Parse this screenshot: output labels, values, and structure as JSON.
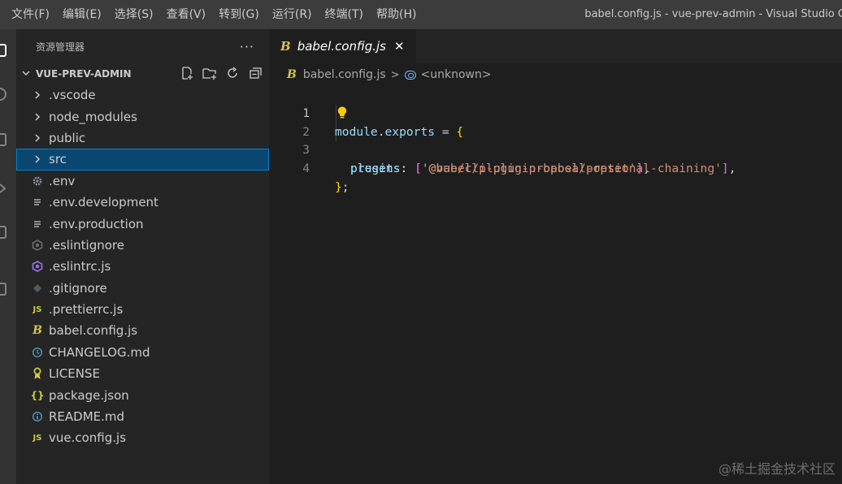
{
  "menubar": {
    "items": [
      "文件(F)",
      "编辑(E)",
      "选择(S)",
      "查看(V)",
      "转到(G)",
      "运行(R)",
      "终端(T)",
      "帮助(H)"
    ],
    "window_title": "babel.config.js - vue-prev-admin - Visual Studio C"
  },
  "sidebar": {
    "title": "资源管理器",
    "more_icon": "···",
    "project_name": "VUE-PREV-ADMIN",
    "items": [
      {
        "label": ".vscode",
        "icon": "chevron-right-icon",
        "type": "folder"
      },
      {
        "label": "node_modules",
        "icon": "chevron-right-icon",
        "type": "folder"
      },
      {
        "label": "public",
        "icon": "chevron-right-icon",
        "type": "folder"
      },
      {
        "label": "src",
        "icon": "chevron-right-icon",
        "type": "folder",
        "selected": true
      },
      {
        "label": ".env",
        "icon": "gear-icon",
        "type": "file"
      },
      {
        "label": ".env.development",
        "icon": "lines-icon",
        "type": "file"
      },
      {
        "label": ".env.production",
        "icon": "lines-icon",
        "type": "file"
      },
      {
        "label": ".eslintignore",
        "icon": "eslint-gray-icon",
        "type": "file"
      },
      {
        "label": ".eslintrc.js",
        "icon": "eslint-purple-icon",
        "type": "file"
      },
      {
        "label": ".gitignore",
        "icon": "git-icon",
        "type": "file"
      },
      {
        "label": ".prettierrc.js",
        "icon": "js-icon",
        "type": "file"
      },
      {
        "label": "babel.config.js",
        "icon": "babel-icon",
        "type": "file"
      },
      {
        "label": "CHANGELOG.md",
        "icon": "clock-icon",
        "type": "file"
      },
      {
        "label": "LICENSE",
        "icon": "license-icon",
        "type": "file"
      },
      {
        "label": "package.json",
        "icon": "json-icon",
        "type": "file"
      },
      {
        "label": "README.md",
        "icon": "info-icon",
        "type": "file"
      },
      {
        "label": "vue.config.js",
        "icon": "js-icon",
        "type": "file"
      }
    ]
  },
  "editor": {
    "tab_label": "babel.config.js",
    "tab_close": "✕",
    "breadcrumb": {
      "file": "babel.config.js",
      "separator": ">",
      "symbol": "<unknown>"
    },
    "line_numbers": [
      "1",
      "2",
      "3",
      "4"
    ],
    "code": {
      "l1_a": "module",
      "l1_b": ".",
      "l1_c": "exports",
      "l1_d": " = ",
      "l1_e": "{",
      "l2_a": "presets",
      "l2_b": ": ",
      "l2_c": "[",
      "l2_d": "'@vue/cli-plugin-babel/preset'",
      "l2_e": "]",
      "l2_f": ",",
      "l3_a": "plugins",
      "l3_b": ": ",
      "l3_c": "[",
      "l3_d": "'@babel/plugin-proposal-optional-chaining'",
      "l3_e": "]",
      "l3_f": ",",
      "l4_a": "}",
      "l4_b": ";"
    }
  },
  "watermark": "@稀土掘金技术社区"
}
